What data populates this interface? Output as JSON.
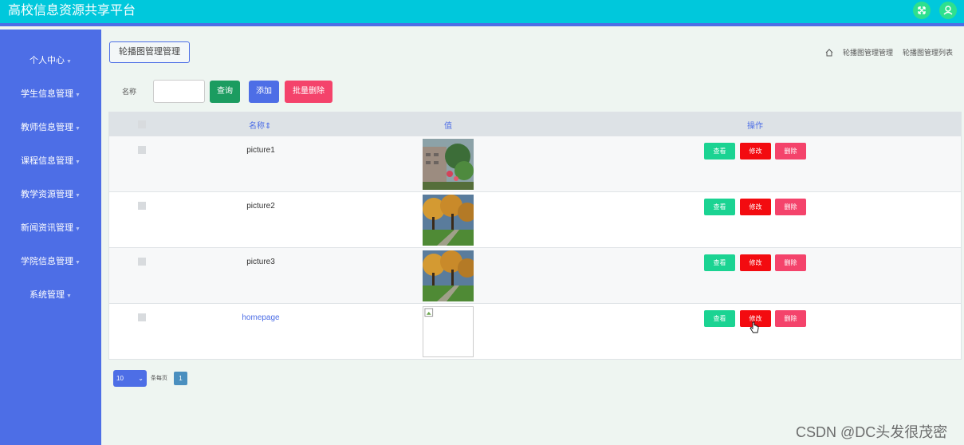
{
  "app": {
    "title": "高校信息资源共享平台"
  },
  "colors": {
    "topbar": "#00c8dc",
    "sidebar": "#4d6ee6",
    "view": "#1bd392",
    "edit": "#f30b10",
    "delete": "#f4436b",
    "primary": "#4d6ee6",
    "search": "#1b9c60",
    "batch_delete": "#f4436b"
  },
  "top_icons": [
    {
      "name": "fullscreen-icon"
    },
    {
      "name": "user-icon"
    }
  ],
  "sidebar": {
    "items": [
      {
        "label": "个人中心"
      },
      {
        "label": "学生信息管理"
      },
      {
        "label": "教师信息管理"
      },
      {
        "label": "课程信息管理"
      },
      {
        "label": "教学资源管理"
      },
      {
        "label": "新闻资讯管理"
      },
      {
        "label": "学院信息管理"
      },
      {
        "label": "系统管理"
      }
    ]
  },
  "breadcrumb": {
    "button": "轮播图管理管理",
    "path": [
      "轮播图管理管理",
      "轮播图管理列表"
    ]
  },
  "search": {
    "label": "名称",
    "value": "",
    "query_button": "查询",
    "add_button": "添加",
    "batch_delete_button": "批量删除"
  },
  "table": {
    "headers": {
      "name": "名称",
      "value": "值",
      "actions": "操作"
    },
    "sort_icon": "sort-icon",
    "rows": [
      {
        "name": "picture1",
        "image": "campus-building-photo",
        "view": "查看",
        "edit": "修改",
        "delete": "删除"
      },
      {
        "name": "picture2",
        "image": "autumn-trees-photo",
        "view": "查看",
        "edit": "修改",
        "delete": "删除"
      },
      {
        "name": "picture3",
        "image": "autumn-trees-photo",
        "view": "查看",
        "edit": "修改",
        "delete": "删除"
      },
      {
        "name": "homepage",
        "image": "broken-image",
        "view": "查看",
        "edit": "修改",
        "delete": "删除"
      }
    ]
  },
  "pager": {
    "page_size": "10",
    "per_page_text": "条每页",
    "current_page": "1"
  },
  "watermark": "CSDN @DC头发很茂密"
}
